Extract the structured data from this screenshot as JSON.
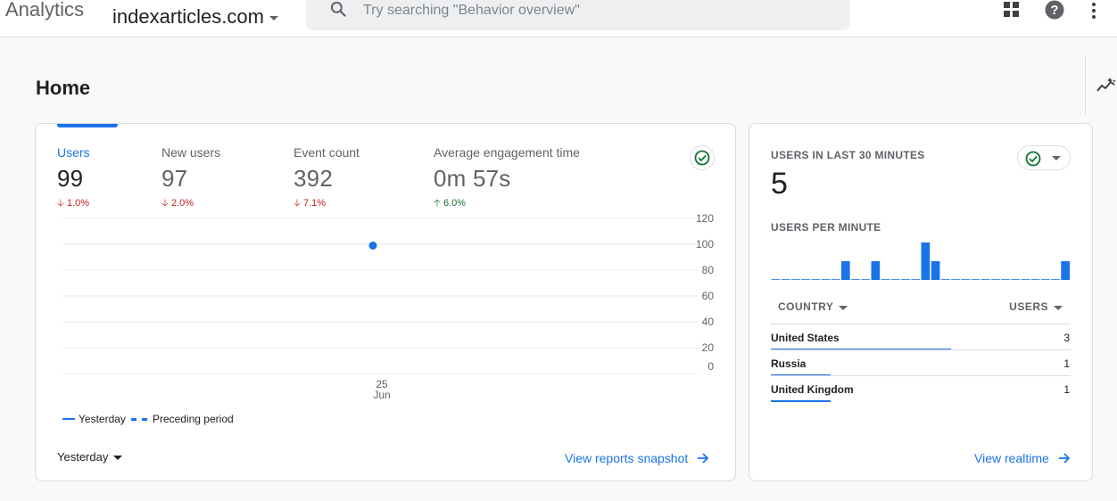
{
  "header": {
    "brand": "Analytics",
    "account": "indexarticles.com",
    "search_placeholder": "Try searching \"Behavior overview\""
  },
  "page": {
    "title": "Home"
  },
  "overview": {
    "metrics": [
      {
        "label": "Users",
        "value": "99",
        "delta": "1.0%",
        "direction": "down"
      },
      {
        "label": "New users",
        "value": "97",
        "delta": "2.0%",
        "direction": "down"
      },
      {
        "label": "Event count",
        "value": "392",
        "delta": "7.1%",
        "direction": "down"
      },
      {
        "label": "Average engagement time",
        "value": "0m 57s",
        "delta": "6.0%",
        "direction": "up"
      }
    ],
    "legend": {
      "current": "Yesterday",
      "previous": "Preceding period"
    },
    "date_range": "Yesterday",
    "view_link": "View reports snapshot"
  },
  "chart_data": {
    "type": "line",
    "x": [
      "25 Jun"
    ],
    "x_tick": {
      "day": "25",
      "month": "Jun"
    },
    "series": [
      {
        "name": "Yesterday",
        "values": [
          99
        ]
      }
    ],
    "y_ticks": [
      "120",
      "100",
      "80",
      "60",
      "40",
      "20",
      "0"
    ],
    "ylim": [
      0,
      120
    ],
    "grid": true,
    "legend_position": "bottom-left"
  },
  "realtime": {
    "heading": "USERS IN LAST 30 MINUTES",
    "value": "5",
    "per_minute_label": "USERS PER MINUTE",
    "per_minute": [
      0,
      0,
      0,
      0,
      0,
      0,
      0,
      1,
      0,
      0,
      1,
      0,
      0,
      0,
      0,
      2,
      1,
      0,
      0,
      0,
      0,
      0,
      0,
      0,
      0,
      0,
      0,
      0,
      0,
      1
    ],
    "table": {
      "col_country": "COUNTRY",
      "col_users": "USERS",
      "rows": [
        {
          "country": "United States",
          "users": "3",
          "share": 0.6
        },
        {
          "country": "Russia",
          "users": "1",
          "share": 0.2
        },
        {
          "country": "United Kingdom",
          "users": "1",
          "share": 0.2
        }
      ]
    },
    "view_link": "View realtime"
  },
  "colors": {
    "accent": "#1a73e8",
    "down": "#c5221f",
    "up": "#137333",
    "check": "#137333"
  }
}
